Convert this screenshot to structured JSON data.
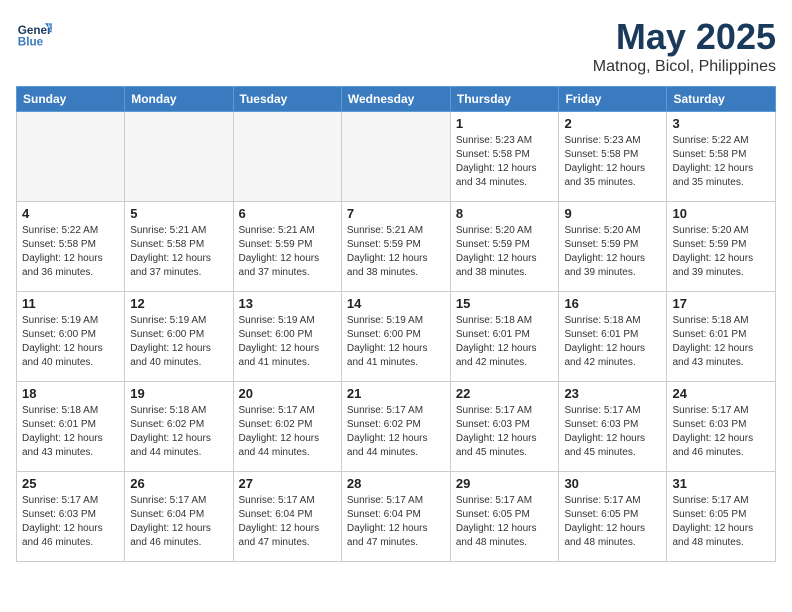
{
  "header": {
    "logo_line1": "General",
    "logo_line2": "Blue",
    "month": "May 2025",
    "location": "Matnog, Bicol, Philippines"
  },
  "weekdays": [
    "Sunday",
    "Monday",
    "Tuesday",
    "Wednesday",
    "Thursday",
    "Friday",
    "Saturday"
  ],
  "weeks": [
    [
      {
        "day": "",
        "info": ""
      },
      {
        "day": "",
        "info": ""
      },
      {
        "day": "",
        "info": ""
      },
      {
        "day": "",
        "info": ""
      },
      {
        "day": "1",
        "info": "Sunrise: 5:23 AM\nSunset: 5:58 PM\nDaylight: 12 hours\nand 34 minutes."
      },
      {
        "day": "2",
        "info": "Sunrise: 5:23 AM\nSunset: 5:58 PM\nDaylight: 12 hours\nand 35 minutes."
      },
      {
        "day": "3",
        "info": "Sunrise: 5:22 AM\nSunset: 5:58 PM\nDaylight: 12 hours\nand 35 minutes."
      }
    ],
    [
      {
        "day": "4",
        "info": "Sunrise: 5:22 AM\nSunset: 5:58 PM\nDaylight: 12 hours\nand 36 minutes."
      },
      {
        "day": "5",
        "info": "Sunrise: 5:21 AM\nSunset: 5:58 PM\nDaylight: 12 hours\nand 37 minutes."
      },
      {
        "day": "6",
        "info": "Sunrise: 5:21 AM\nSunset: 5:59 PM\nDaylight: 12 hours\nand 37 minutes."
      },
      {
        "day": "7",
        "info": "Sunrise: 5:21 AM\nSunset: 5:59 PM\nDaylight: 12 hours\nand 38 minutes."
      },
      {
        "day": "8",
        "info": "Sunrise: 5:20 AM\nSunset: 5:59 PM\nDaylight: 12 hours\nand 38 minutes."
      },
      {
        "day": "9",
        "info": "Sunrise: 5:20 AM\nSunset: 5:59 PM\nDaylight: 12 hours\nand 39 minutes."
      },
      {
        "day": "10",
        "info": "Sunrise: 5:20 AM\nSunset: 5:59 PM\nDaylight: 12 hours\nand 39 minutes."
      }
    ],
    [
      {
        "day": "11",
        "info": "Sunrise: 5:19 AM\nSunset: 6:00 PM\nDaylight: 12 hours\nand 40 minutes."
      },
      {
        "day": "12",
        "info": "Sunrise: 5:19 AM\nSunset: 6:00 PM\nDaylight: 12 hours\nand 40 minutes."
      },
      {
        "day": "13",
        "info": "Sunrise: 5:19 AM\nSunset: 6:00 PM\nDaylight: 12 hours\nand 41 minutes."
      },
      {
        "day": "14",
        "info": "Sunrise: 5:19 AM\nSunset: 6:00 PM\nDaylight: 12 hours\nand 41 minutes."
      },
      {
        "day": "15",
        "info": "Sunrise: 5:18 AM\nSunset: 6:01 PM\nDaylight: 12 hours\nand 42 minutes."
      },
      {
        "day": "16",
        "info": "Sunrise: 5:18 AM\nSunset: 6:01 PM\nDaylight: 12 hours\nand 42 minutes."
      },
      {
        "day": "17",
        "info": "Sunrise: 5:18 AM\nSunset: 6:01 PM\nDaylight: 12 hours\nand 43 minutes."
      }
    ],
    [
      {
        "day": "18",
        "info": "Sunrise: 5:18 AM\nSunset: 6:01 PM\nDaylight: 12 hours\nand 43 minutes."
      },
      {
        "day": "19",
        "info": "Sunrise: 5:18 AM\nSunset: 6:02 PM\nDaylight: 12 hours\nand 44 minutes."
      },
      {
        "day": "20",
        "info": "Sunrise: 5:17 AM\nSunset: 6:02 PM\nDaylight: 12 hours\nand 44 minutes."
      },
      {
        "day": "21",
        "info": "Sunrise: 5:17 AM\nSunset: 6:02 PM\nDaylight: 12 hours\nand 44 minutes."
      },
      {
        "day": "22",
        "info": "Sunrise: 5:17 AM\nSunset: 6:03 PM\nDaylight: 12 hours\nand 45 minutes."
      },
      {
        "day": "23",
        "info": "Sunrise: 5:17 AM\nSunset: 6:03 PM\nDaylight: 12 hours\nand 45 minutes."
      },
      {
        "day": "24",
        "info": "Sunrise: 5:17 AM\nSunset: 6:03 PM\nDaylight: 12 hours\nand 46 minutes."
      }
    ],
    [
      {
        "day": "25",
        "info": "Sunrise: 5:17 AM\nSunset: 6:03 PM\nDaylight: 12 hours\nand 46 minutes."
      },
      {
        "day": "26",
        "info": "Sunrise: 5:17 AM\nSunset: 6:04 PM\nDaylight: 12 hours\nand 46 minutes."
      },
      {
        "day": "27",
        "info": "Sunrise: 5:17 AM\nSunset: 6:04 PM\nDaylight: 12 hours\nand 47 minutes."
      },
      {
        "day": "28",
        "info": "Sunrise: 5:17 AM\nSunset: 6:04 PM\nDaylight: 12 hours\nand 47 minutes."
      },
      {
        "day": "29",
        "info": "Sunrise: 5:17 AM\nSunset: 6:05 PM\nDaylight: 12 hours\nand 48 minutes."
      },
      {
        "day": "30",
        "info": "Sunrise: 5:17 AM\nSunset: 6:05 PM\nDaylight: 12 hours\nand 48 minutes."
      },
      {
        "day": "31",
        "info": "Sunrise: 5:17 AM\nSunset: 6:05 PM\nDaylight: 12 hours\nand 48 minutes."
      }
    ]
  ]
}
